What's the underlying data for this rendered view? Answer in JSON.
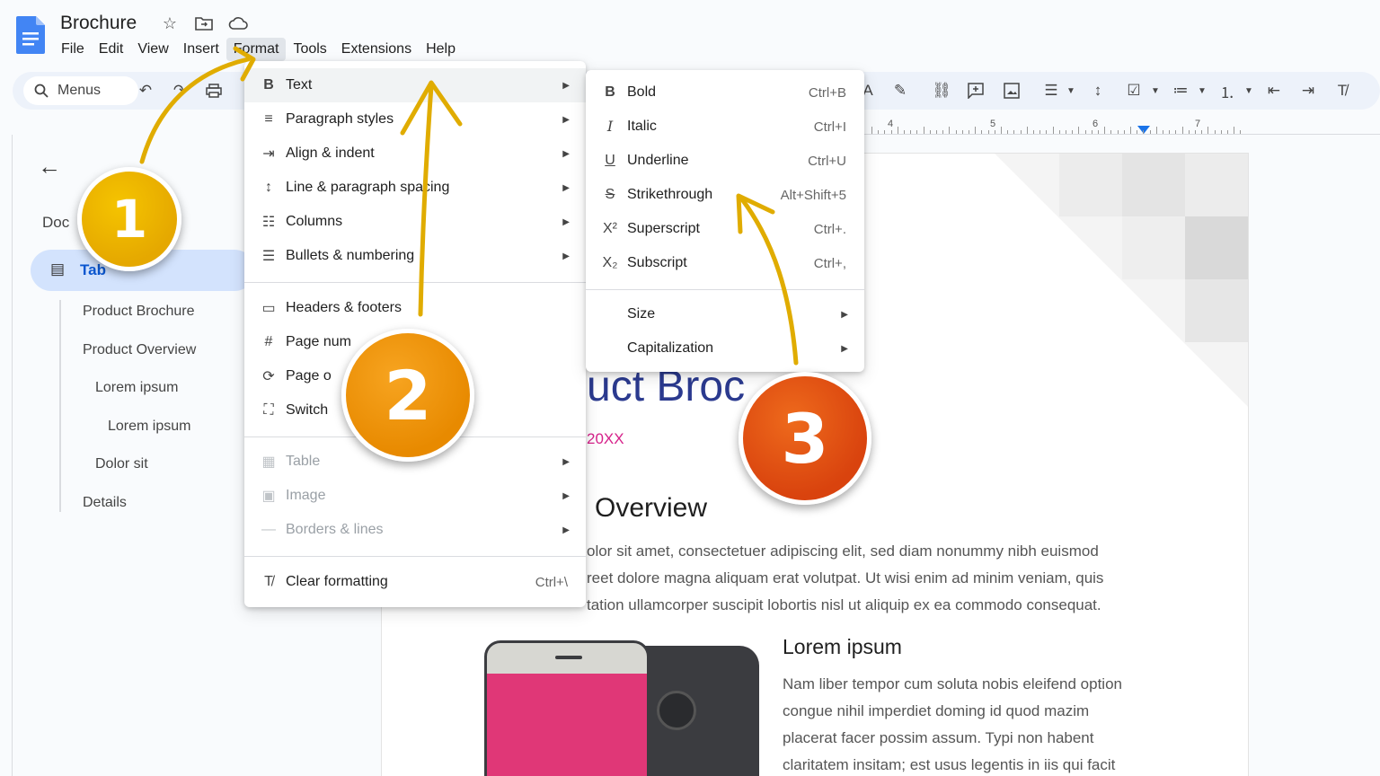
{
  "app": {
    "title": "Brochure",
    "menu": [
      "File",
      "Edit",
      "View",
      "Insert",
      "Format",
      "Tools",
      "Extensions",
      "Help"
    ],
    "active_menu": "Format"
  },
  "toolbar": {
    "search_label": "Menus"
  },
  "ruler": {
    "numbers": [
      "4",
      "5",
      "6",
      "7"
    ]
  },
  "outline": {
    "doc_label": "Doc",
    "tab_label": "Tab",
    "items": [
      "Product Brochure",
      "Product Overview",
      "Lorem ipsum",
      "Lorem ipsum",
      "Dolor sit",
      "Details"
    ]
  },
  "format_menu": {
    "items": [
      {
        "icon": "bold-icon",
        "label": "Text",
        "submenu": true
      },
      {
        "icon": "paragraph-styles-icon",
        "label": "Paragraph styles",
        "submenu": true
      },
      {
        "icon": "align-indent-icon",
        "label": "Align & indent",
        "submenu": true
      },
      {
        "icon": "line-spacing-icon",
        "label": "Line & paragraph spacing",
        "submenu": true
      },
      {
        "icon": "columns-icon",
        "label": "Columns",
        "submenu": true
      },
      {
        "icon": "bullets-icon",
        "label": "Bullets & numbering",
        "submenu": true
      },
      {
        "icon": "headers-footers-icon",
        "label": "Headers & footers",
        "submenu": false
      },
      {
        "icon": "hash-icon",
        "label": "Page num",
        "submenu": false
      },
      {
        "icon": "page-orientation-icon",
        "label": "Page o",
        "submenu": false
      },
      {
        "icon": "switch-icon",
        "label": "Switch",
        "submenu": false
      },
      {
        "icon": "table-icon",
        "label": "Table",
        "submenu": true
      },
      {
        "icon": "image-icon",
        "label": "Image",
        "submenu": true
      },
      {
        "icon": "borders-icon",
        "label": "Borders & lines",
        "submenu": true
      },
      {
        "icon": "clear-formatting-icon",
        "label": "Clear formatting",
        "shortcut": "Ctrl+\\"
      }
    ]
  },
  "text_menu": {
    "items": [
      {
        "icon": "bold-icon",
        "label": "Bold",
        "shortcut": "Ctrl+B"
      },
      {
        "icon": "italic-icon",
        "label": "Italic",
        "shortcut": "Ctrl+I"
      },
      {
        "icon": "underline-icon",
        "label": "Underline",
        "shortcut": "Ctrl+U"
      },
      {
        "icon": "strikethrough-icon",
        "label": "Strikethrough",
        "shortcut": "Alt+Shift+5"
      },
      {
        "icon": "superscript-icon",
        "label": "Superscript",
        "shortcut": "Ctrl+."
      },
      {
        "icon": "subscript-icon",
        "label": "Subscript",
        "shortcut": "Ctrl+,"
      },
      {
        "label": "Size"
      },
      {
        "label": "Capitalization"
      }
    ]
  },
  "page": {
    "title": "uct Broc",
    "date": "20XX",
    "heading": "Overview",
    "body": [
      "olor sit amet, consectetuer adipiscing elit, sed diam nonummy nibh euismod",
      "reet dolore magna aliquam erat volutpat. Ut wisi enim ad minim veniam, quis",
      "tation ullamcorper suscipit lobortis nisl ut aliquip ex ea commodo consequat."
    ],
    "subheading": "Lorem ipsum",
    "body2": [
      "Nam liber tempor cum soluta nobis eleifend option",
      "congue nihil imperdiet doming id quod mazim",
      "placerat facer possim assum. Typi non habent",
      "claritatem insitam; est usus legentis in iis qui facit"
    ]
  },
  "badges": [
    "1",
    "2",
    "3"
  ],
  "colors": {
    "badge1": "#e5a800",
    "badge2": "#e88a00",
    "badge3": "#d9430e",
    "arrow": "#e0ac00",
    "selection": "#d3e3fd"
  }
}
